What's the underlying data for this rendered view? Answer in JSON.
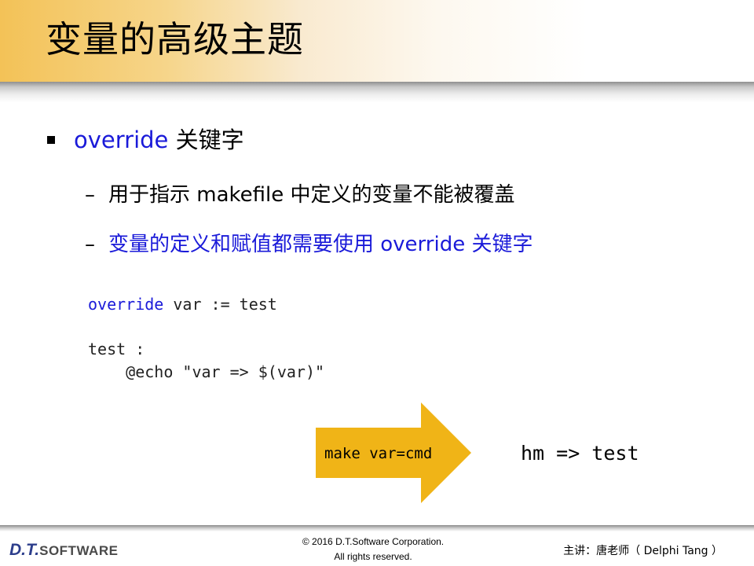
{
  "title": "变量的高级主题",
  "bullet": {
    "keyword": "override",
    "text": " 关键字"
  },
  "subpoints": [
    {
      "text": "用于指示 makefile 中定义的变量不能被覆盖"
    },
    {
      "text": "变量的定义和赋值都需要使用 override 关键字"
    }
  ],
  "code": {
    "line1_keyword": "override",
    "line1_rest": " var := test",
    "line2": "test :",
    "line3": "\t@echo \"var => $(var)\""
  },
  "arrow": {
    "label": "make var=cmd",
    "color": "#f0b417"
  },
  "result": "hm => test",
  "footer": {
    "logo_dt": "D.T.",
    "logo_software": "SOFTWARE",
    "copyright_line1": "© 2016 D.T.Software Corporation.",
    "copyright_line2": "All rights reserved.",
    "presenter": "主讲：唐老师（ Delphi Tang ）"
  },
  "colors": {
    "keyword_blue": "#1a1ad9",
    "title_band": "#f3c257"
  }
}
